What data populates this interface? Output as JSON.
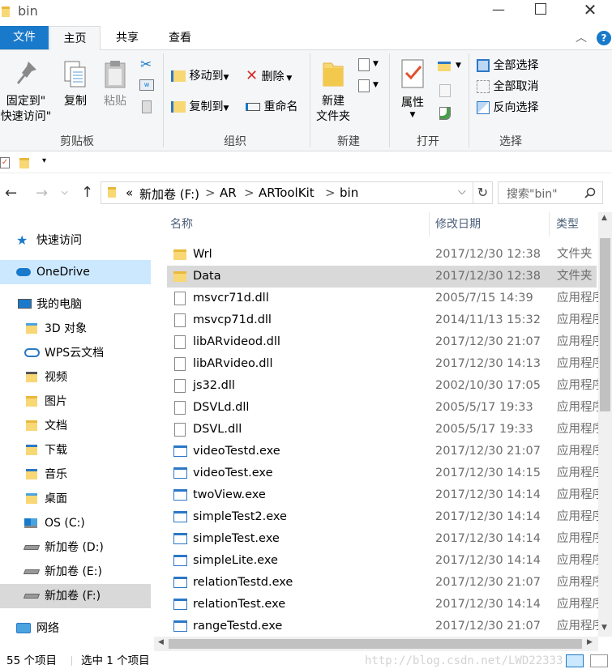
{
  "window": {
    "title": "bin"
  },
  "tabs": [
    {
      "label": "文件"
    },
    {
      "label": "主页"
    },
    {
      "label": "共享"
    },
    {
      "label": "查看"
    }
  ],
  "ribbon": {
    "clipboard": {
      "pin_label_1": "固定到\"",
      "pin_label_2": "快速访问\"",
      "copy": "复制",
      "paste": "粘贴",
      "group": "剪贴板"
    },
    "organize": {
      "move_to": "移动到",
      "delete": "删除",
      "copy_to": "复制到",
      "rename": "重命名",
      "group": "组织"
    },
    "new": {
      "new_folder_1": "新建",
      "new_folder_2": "文件夹",
      "group": "新建"
    },
    "open": {
      "properties": "属性",
      "group": "打开"
    },
    "select": {
      "select_all": "全部选择",
      "select_none": "全部取消",
      "invert": "反向选择",
      "group": "选择"
    }
  },
  "address": {
    "overflow": "«",
    "crumbs": [
      "新加卷 (F:)",
      "AR",
      "ARToolKit",
      "bin"
    ],
    "sep": ">",
    "search_placeholder": "搜索\"bin\""
  },
  "sidebar": {
    "items": [
      {
        "label": "快速访问",
        "icon": "star-icon"
      },
      {
        "label": "OneDrive",
        "icon": "cloud-icon"
      },
      {
        "label": "我的电脑",
        "icon": "computer-icon"
      },
      {
        "label": "3D 对象",
        "icon": "cube-folder-icon"
      },
      {
        "label": "WPS云文档",
        "icon": "cloud-outline-icon"
      },
      {
        "label": "视频",
        "icon": "video-folder-icon"
      },
      {
        "label": "图片",
        "icon": "picture-folder-icon"
      },
      {
        "label": "文档",
        "icon": "document-folder-icon"
      },
      {
        "label": "下载",
        "icon": "download-folder-icon"
      },
      {
        "label": "音乐",
        "icon": "music-folder-icon"
      },
      {
        "label": "桌面",
        "icon": "desktop-folder-icon"
      },
      {
        "label": "OS (C:)",
        "icon": "windows-drive-icon"
      },
      {
        "label": "新加卷 (D:)",
        "icon": "drive-icon"
      },
      {
        "label": "新加卷 (E:)",
        "icon": "drive-icon"
      },
      {
        "label": "新加卷 (F:)",
        "icon": "drive-icon"
      },
      {
        "label": "网络",
        "icon": "network-icon"
      }
    ]
  },
  "columns": {
    "name": "名称",
    "date": "修改日期",
    "type": "类型"
  },
  "files": [
    {
      "name": "Wrl",
      "date": "2017/12/30 12:38",
      "type": "文件夹",
      "kind": "folder"
    },
    {
      "name": "Data",
      "date": "2017/12/30 12:38",
      "type": "文件夹",
      "kind": "folder"
    },
    {
      "name": "msvcr71d.dll",
      "date": "2005/7/15 14:39",
      "type": "应用程序",
      "kind": "dll"
    },
    {
      "name": "msvcp71d.dll",
      "date": "2014/11/13 15:32",
      "type": "应用程序",
      "kind": "dll"
    },
    {
      "name": "libARvideod.dll",
      "date": "2017/12/30 21:07",
      "type": "应用程序",
      "kind": "dll"
    },
    {
      "name": "libARvideo.dll",
      "date": "2017/12/30 14:13",
      "type": "应用程序",
      "kind": "dll"
    },
    {
      "name": "js32.dll",
      "date": "2002/10/30 17:05",
      "type": "应用程序",
      "kind": "dll"
    },
    {
      "name": "DSVLd.dll",
      "date": "2005/5/17 19:33",
      "type": "应用程序",
      "kind": "dll"
    },
    {
      "name": "DSVL.dll",
      "date": "2005/5/17 19:33",
      "type": "应用程序",
      "kind": "dll"
    },
    {
      "name": "videoTestd.exe",
      "date": "2017/12/30 21:07",
      "type": "应用程序",
      "kind": "exe"
    },
    {
      "name": "videoTest.exe",
      "date": "2017/12/30 14:15",
      "type": "应用程序",
      "kind": "exe"
    },
    {
      "name": "twoView.exe",
      "date": "2017/12/30 14:14",
      "type": "应用程序",
      "kind": "exe"
    },
    {
      "name": "simpleTest2.exe",
      "date": "2017/12/30 14:14",
      "type": "应用程序",
      "kind": "exe"
    },
    {
      "name": "simpleTest.exe",
      "date": "2017/12/30 14:14",
      "type": "应用程序",
      "kind": "exe"
    },
    {
      "name": "simpleLite.exe",
      "date": "2017/12/30 14:14",
      "type": "应用程序",
      "kind": "exe"
    },
    {
      "name": "relationTestd.exe",
      "date": "2017/12/30 21:07",
      "type": "应用程序",
      "kind": "exe"
    },
    {
      "name": "relationTest.exe",
      "date": "2017/12/30 14:14",
      "type": "应用程序",
      "kind": "exe"
    },
    {
      "name": "rangeTestd.exe",
      "date": "2017/12/30 21:07",
      "type": "应用程序",
      "kind": "exe"
    }
  ],
  "status": {
    "count": "55 个项目",
    "selected": "选中 1 个项目"
  },
  "watermark": "http://blog.csdn.net/LWD22333",
  "colors": {
    "accent": "#1979ca",
    "selection": "#d9d9d9",
    "onedrive_hover": "#cce8ff"
  }
}
